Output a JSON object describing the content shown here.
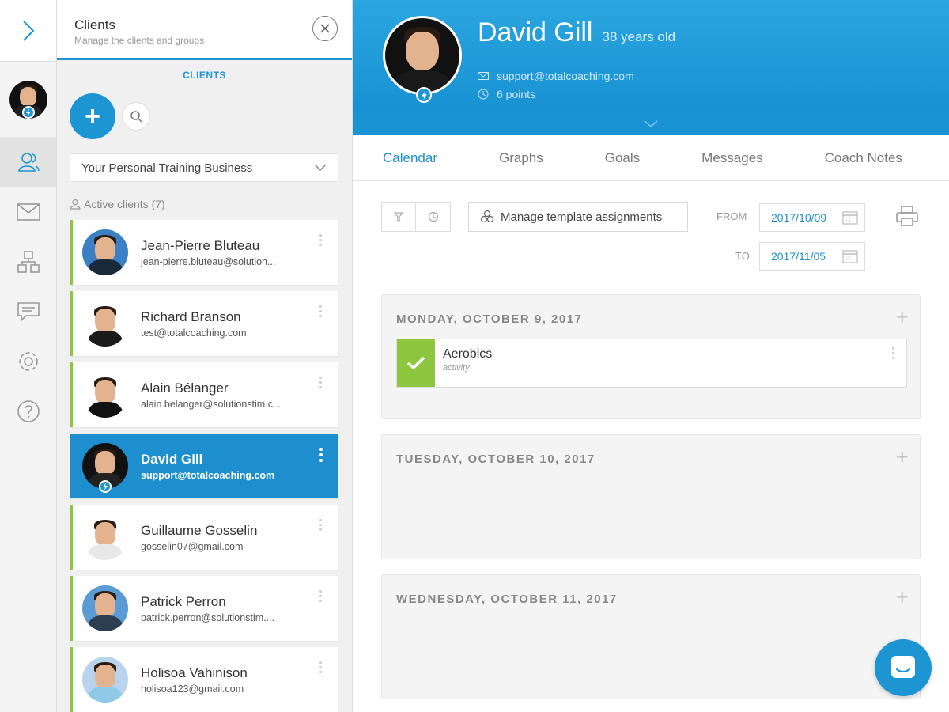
{
  "rail": {
    "items": [
      {
        "icon": "clients-icon",
        "active": true
      },
      {
        "icon": "mail-icon"
      },
      {
        "icon": "groups-icon"
      },
      {
        "icon": "chat-icon"
      },
      {
        "icon": "settings-icon"
      },
      {
        "icon": "help-icon"
      }
    ]
  },
  "clients_panel": {
    "title": "Clients",
    "subtitle": "Manage the clients and groups",
    "tab_label": "CLIENTS",
    "add_label": "+",
    "group_select": "Your Personal Training Business",
    "active_clients": "Active clients (7)"
  },
  "clients": [
    {
      "name": "Jean-Pierre Bluteau",
      "email": "jean-pierre.bluteau@solution...",
      "bg": "#3b7fc4",
      "shirt": "#1b2a3a"
    },
    {
      "name": "Richard Branson",
      "email": "test@totalcoaching.com",
      "bg": "#ffffff",
      "shirt": "#1a1a1a"
    },
    {
      "name": "Alain Bélanger",
      "email": "alain.belanger@solutionstim.c...",
      "bg": "#ffffff",
      "shirt": "#111111"
    },
    {
      "name": "David Gill",
      "email": "support@totalcoaching.com",
      "bg": "#111111",
      "shirt": "#222222",
      "selected": true
    },
    {
      "name": "Guillaume Gosselin",
      "email": "gosselin07@gmail.com",
      "bg": "#ffffff",
      "shirt": "#e8e8e8"
    },
    {
      "name": "Patrick Perron",
      "email": "patrick.perron@solutionstim....",
      "bg": "#5a9bd6",
      "shirt": "#2c3e50"
    },
    {
      "name": "Holisoa Vahinison",
      "email": "holisoa123@gmail.com",
      "bg": "#b8d4ec",
      "shirt": "#8ec9e8"
    }
  ],
  "profile": {
    "name": "David Gill",
    "age": "38 years old",
    "email": "support@totalcoaching.com",
    "points": "6 points"
  },
  "tabs": [
    "Calendar",
    "Graphs",
    "Goals",
    "Messages",
    "Coach Notes"
  ],
  "toolbar": {
    "template_label": "Manage template assignments",
    "from_label": "FROM",
    "from_date": "2017/10/09",
    "to_label": "TO",
    "to_date": "2017/11/05"
  },
  "days": [
    {
      "title": "MONDAY, OCTOBER 9, 2017",
      "events": [
        {
          "name": "Aerobics",
          "type": "activity"
        }
      ]
    },
    {
      "title": "TUESDAY, OCTOBER 10, 2017",
      "events": []
    },
    {
      "title": "WEDNESDAY, OCTOBER 11, 2017",
      "events": []
    }
  ],
  "colors": {
    "accent": "#1d95d2",
    "success": "#8dc63f"
  }
}
